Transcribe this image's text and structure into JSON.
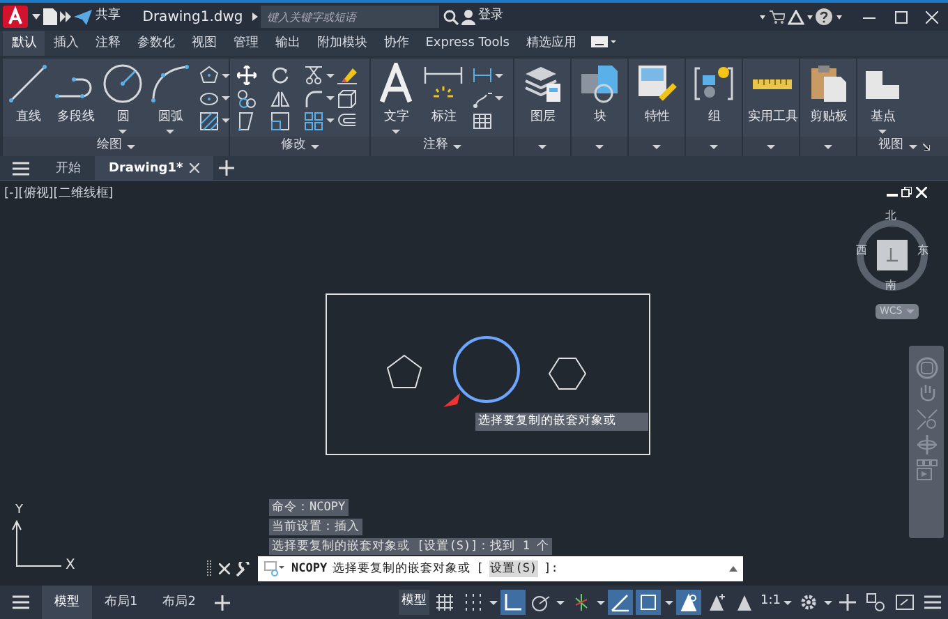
{
  "title_bar": {
    "share": "共享",
    "document_title": "Drawing1.dwg",
    "search": {
      "placeholder": "键入关键字或短语"
    },
    "sign_in": "登录"
  },
  "ribbon_tabs": [
    {
      "label": "默认",
      "selected": true
    },
    {
      "label": "插入",
      "selected": false
    },
    {
      "label": "注释",
      "selected": false
    },
    {
      "label": "参数化",
      "selected": false
    },
    {
      "label": "视图",
      "selected": false
    },
    {
      "label": "管理",
      "selected": false
    },
    {
      "label": "输出",
      "selected": false
    },
    {
      "label": "附加模块",
      "selected": false
    },
    {
      "label": "协作",
      "selected": false
    },
    {
      "label": "Express Tools",
      "selected": false
    },
    {
      "label": "精选应用",
      "selected": false
    }
  ],
  "ribbon_panels": [
    {
      "kind": "draw",
      "title": "绘图",
      "tools": [
        {
          "label": "直线",
          "dropdown": false
        },
        {
          "label": "多段线",
          "dropdown": false
        },
        {
          "label": "圆",
          "dropdown": true
        },
        {
          "label": "圆弧",
          "dropdown": true
        }
      ]
    },
    {
      "kind": "modify",
      "title": "修改"
    },
    {
      "kind": "annotate",
      "title": "注释",
      "tools": [
        {
          "label": "文字",
          "dropdown": true
        },
        {
          "label": "标注",
          "dropdown": false
        }
      ]
    },
    {
      "kind": "single",
      "tools": [
        {
          "label": "图层",
          "dropdown": false
        }
      ]
    },
    {
      "kind": "single",
      "tools": [
        {
          "label": "块",
          "dropdown": false
        }
      ]
    },
    {
      "kind": "single",
      "tools": [
        {
          "label": "特性",
          "dropdown": false
        }
      ]
    },
    {
      "kind": "single",
      "tools": [
        {
          "label": "组",
          "dropdown": false
        }
      ]
    },
    {
      "kind": "single",
      "tools": [
        {
          "label": "实用工具",
          "dropdown": false
        }
      ]
    },
    {
      "kind": "single",
      "tools": [
        {
          "label": "剪贴板",
          "dropdown": false
        }
      ]
    },
    {
      "kind": "view",
      "title": "视图",
      "tools": [
        {
          "label": "基点",
          "dropdown": true
        }
      ]
    }
  ],
  "file_tabs": [
    {
      "label": "开始",
      "selected": false
    },
    {
      "label": "Drawing1*",
      "selected": true
    }
  ],
  "viewport_label": "[-][俯视][二维线框]",
  "canvas": {
    "tooltip": "选择要复制的嵌套对象或"
  },
  "viewcube": {
    "north": "北",
    "south": "南",
    "east": "东",
    "west": "西",
    "coordinate_system": "WCS"
  },
  "ucs": {
    "x_label": "X",
    "y_label": "Y"
  },
  "command_history": [
    "命令：NCOPY",
    "当前设置：插入",
    "选择要复制的嵌套对象或 [设置(S)]：找到 1 个"
  ],
  "command_line": {
    "command": "NCOPY",
    "prompt": "选择要复制的嵌套对象或",
    "open_bracket": "[",
    "option": "设置(S)",
    "close": "]:"
  },
  "layout_tabs": [
    {
      "label": "模型",
      "selected": true
    },
    {
      "label": "布局1",
      "selected": false
    },
    {
      "label": "布局2",
      "selected": false
    }
  ],
  "status_bar": {
    "model_button": "模型",
    "scale": "1:1"
  }
}
